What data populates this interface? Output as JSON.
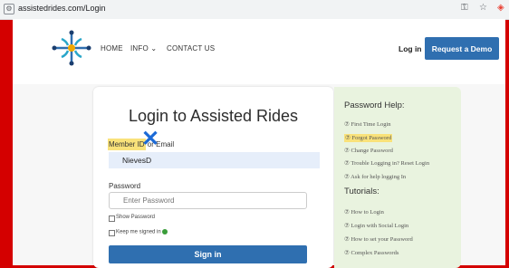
{
  "browser": {
    "url": "assistedrides.com/Login",
    "icons": [
      "tune-icon",
      "key-icon",
      "star-icon",
      "extension-icon"
    ]
  },
  "nav": {
    "home": "HOME",
    "info": "INFO",
    "contact": "CONTACT US",
    "login": "Log in",
    "demo": "Request a Demo"
  },
  "login": {
    "title": "Login to Assisted Rides",
    "member_label_highlight": "Member ID",
    "member_label_rest": " or Email",
    "member_value": "NievesD",
    "password_label": "Password",
    "password_placeholder": "Enter Password",
    "show_password": "Show Password",
    "keep_signed_in": "Keep me signed in",
    "signin": "Sign in"
  },
  "help": {
    "title": "Password Help:",
    "items": [
      "⑦ First Time Login",
      "⑦ Forgot Password",
      "⑦ Change Password",
      "⑦ Trouble Logging in? Reset Login",
      "⑦ Ask for help logging In"
    ],
    "tutorials_title": "Tutorials:",
    "tutorials": [
      "⑦ How to Login",
      "⑦ Login with Social Login",
      "⑦ How to set your Password",
      "⑦ Complex Passwords"
    ]
  },
  "colors": {
    "accent": "#2f6fb0",
    "highlight": "#f9e27a",
    "annotation": "#1c6ad6",
    "frame": "#d40000",
    "help_bg": "#e9f3df"
  }
}
